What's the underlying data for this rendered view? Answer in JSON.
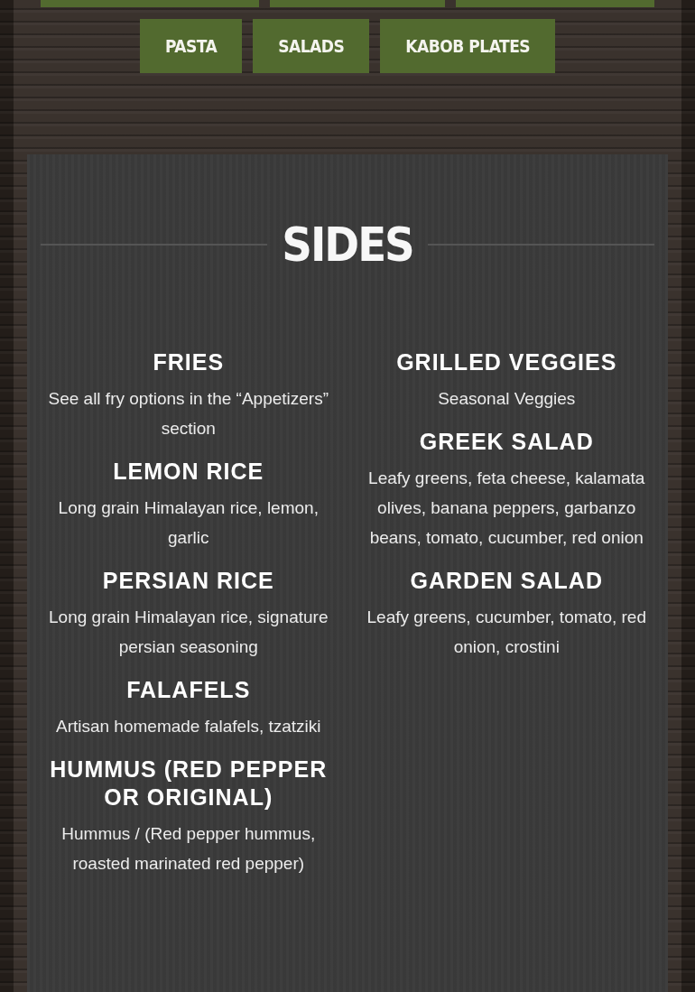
{
  "category_buttons_top_row": [
    {
      "kind": "button"
    },
    {
      "kind": "button"
    },
    {
      "kind": "button"
    }
  ],
  "category_buttons": [
    {
      "label": "PASTA"
    },
    {
      "label": "SALADS"
    },
    {
      "label": "KABOB PLATES"
    }
  ],
  "section": {
    "title": "SIDES",
    "columns": [
      {
        "items": [
          {
            "name": "FRIES",
            "description": "See all fry options in the “Appetizers” section"
          },
          {
            "name": "LEMON RICE",
            "description": "Long grain Himalayan rice, lemon, garlic"
          },
          {
            "name": "PERSIAN RICE",
            "description": "Long grain Himalayan rice, signature persian seasoning"
          },
          {
            "name": "FALAFELS",
            "description": "Artisan homemade falafels, tzatziki"
          },
          {
            "name": "HUMMUS (RED PEPPER OR ORIGINAL)",
            "description": "Hummus / (Red pepper hummus, roasted marinated red pepper)"
          }
        ]
      },
      {
        "items": [
          {
            "name": "GRILLED VEGGIES",
            "description": "Seasonal Veggies"
          },
          {
            "name": "GREEK SALAD",
            "description": "Leafy greens, feta cheese, kalamata olives, banana peppers, garbanzo beans, tomato, cucumber, red onion"
          },
          {
            "name": "GARDEN SALAD",
            "description": "Leafy greens, cucumber, tomato, red onion, crostini"
          }
        ]
      }
    ]
  }
}
